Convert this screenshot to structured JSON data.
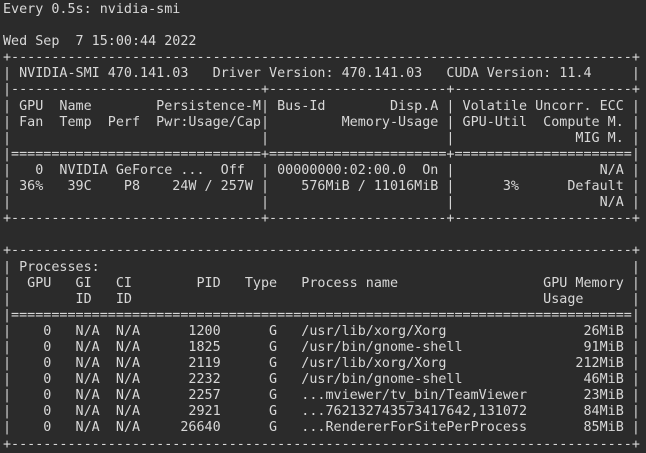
{
  "terminal": {
    "lines": [
      "Every 0.5s: nvidia-smi",
      "",
      "Wed Sep  7 15:00:44 2022",
      "+-----------------------------------------------------------------------------+",
      "| NVIDIA-SMI 470.141.03   Driver Version: 470.141.03   CUDA Version: 11.4     |",
      "|-------------------------------+----------------------+----------------------+",
      "| GPU  Name        Persistence-M| Bus-Id        Disp.A | Volatile Uncorr. ECC |",
      "| Fan  Temp  Perf  Pwr:Usage/Cap|         Memory-Usage | GPU-Util  Compute M. |",
      "|                               |                      |               MIG M. |",
      "|===============================+======================+======================|",
      "|   0  NVIDIA GeForce ...  Off  | 00000000:02:00.0  On |                  N/A |",
      "| 36%   39C    P8    24W / 257W |    576MiB / 11016MiB |      3%      Default |",
      "|                               |                      |                  N/A |",
      "+-------------------------------+----------------------+----------------------+",
      "",
      "+-----------------------------------------------------------------------------+",
      "| Processes:                                                                  |",
      "|  GPU   GI   CI        PID   Type   Process name                  GPU Memory |",
      "|        ID   ID                                                   Usage      |",
      "|=============================================================================|",
      "|    0   N/A  N/A      1200      G   /usr/lib/xorg/Xorg                 26MiB |",
      "|    0   N/A  N/A      1825      G   /usr/bin/gnome-shell               91MiB |",
      "|    0   N/A  N/A      2119      G   /usr/lib/xorg/Xorg                212MiB |",
      "|    0   N/A  N/A      2232      G   /usr/bin/gnome-shell               46MiB |",
      "|    0   N/A  N/A      2257      G   ...mviewer/tv_bin/TeamViewer       23MiB |",
      "|    0   N/A  N/A      2921      G   ...762132743573417642,131072       84MiB |",
      "|    0   N/A  N/A     26640      G   ...RendererForSitePerProcess       85MiB |",
      "+-----------------------------------------------------------------------------+"
    ]
  },
  "colors": {
    "background": "#2b2b2b",
    "foreground": "#d8d8d8"
  }
}
